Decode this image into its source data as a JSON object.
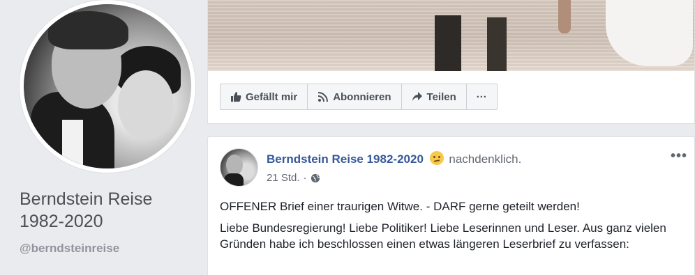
{
  "profile": {
    "name": "Berndstein Reise 1982-2020",
    "handle": "@berndsteinreise"
  },
  "actions": [
    {
      "label": "Gefällt mir",
      "icon": "thumbs-up-icon"
    },
    {
      "label": "Abonnieren",
      "icon": "rss-icon"
    },
    {
      "label": "Teilen",
      "icon": "share-arrow-icon"
    },
    {
      "label": "···",
      "icon": "more-icon"
    }
  ],
  "post": {
    "author": "Berndstein Reise 1982-2020",
    "feeling": "nachdenklich.",
    "time": "21 Std.",
    "separator": "·",
    "menu": "•••",
    "paragraphs": [
      "OFFENER Brief einer traurigen Witwe. - DARF gerne geteilt werden!",
      "Liebe Bundesregierung! Liebe Politiker! Liebe Leserinnen und Leser. Aus ganz vielen Gründen habe ich beschlossen einen etwas längeren Leserbrief zu verfassen:"
    ]
  },
  "colors": {
    "background": "#e9ebee",
    "link": "#365899",
    "secondary_text": "#616770"
  }
}
